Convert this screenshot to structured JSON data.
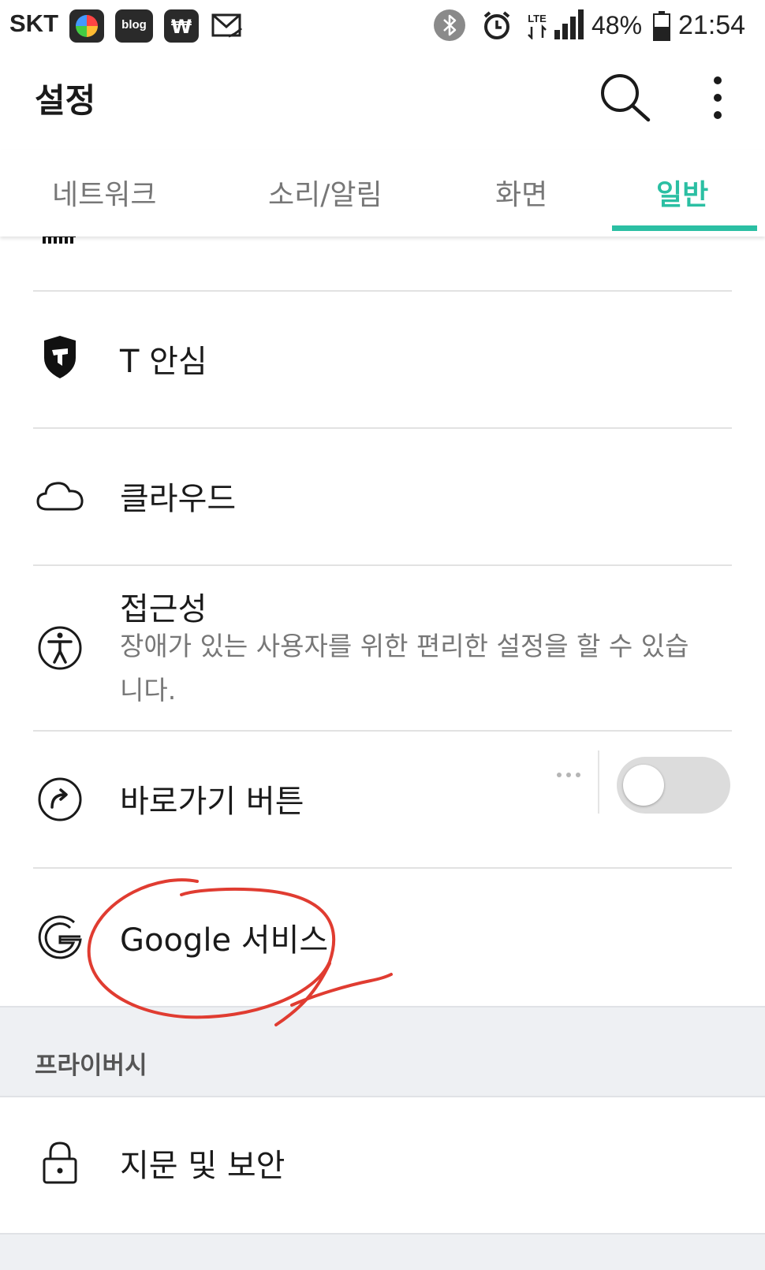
{
  "status_bar": {
    "carrier": "SKT",
    "blog_label": "blog",
    "house_label": "₩",
    "battery_percent": "48%",
    "time": "21:54",
    "lte_label": "LTE"
  },
  "header": {
    "title": "설정"
  },
  "tabs": [
    {
      "label": "네트워크"
    },
    {
      "label": "소리/알림"
    },
    {
      "label": "화면"
    },
    {
      "label": "일반"
    }
  ],
  "active_tab": "일반",
  "items": [
    {
      "title": "T 안심",
      "icon": "shield-t-icon"
    },
    {
      "title": "클라우드",
      "icon": "cloud-icon"
    },
    {
      "title": "접근성",
      "subtitle": "장애가 있는 사용자를 위한 편리한 설정을 할 수 있습니다.",
      "icon": "accessibility-icon"
    },
    {
      "title": "바로가기 버튼",
      "icon": "shortcut-arrow-icon",
      "toggle": false
    },
    {
      "title": "Google 서비스",
      "icon": "google-icon"
    }
  ],
  "section": {
    "label": "프라이버시"
  },
  "privacy_items": [
    {
      "title": "지문 및 보안",
      "icon": "lock-icon"
    }
  ],
  "colors": {
    "accent": "#2bbfa3",
    "annotation": "#e03c31",
    "section_bg": "#eef0f3"
  }
}
